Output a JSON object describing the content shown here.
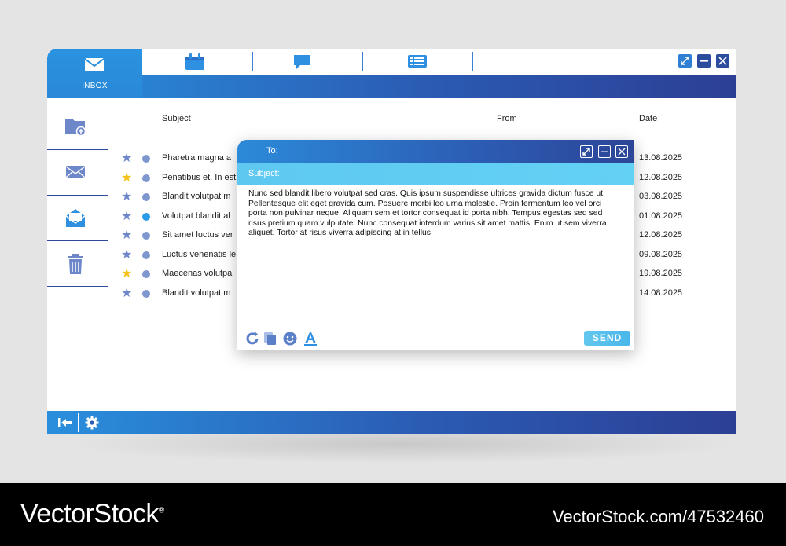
{
  "tabs": {
    "inbox_label": "INBOX",
    "icons": [
      "envelope-icon",
      "calendar-icon",
      "chat-icon",
      "list-icon"
    ]
  },
  "window_controls": [
    "expand-icon",
    "minimize-icon",
    "close-icon"
  ],
  "sidebar": {
    "items": [
      "new-folder-icon",
      "mail-icon",
      "open-mail-icon",
      "trash-icon"
    ]
  },
  "list": {
    "headers": {
      "subject": "Subject",
      "from": "From",
      "date": "Date"
    },
    "rows": [
      {
        "subject": "Pharetra magna a",
        "date": "13.08.2025",
        "starred": false,
        "unread": false
      },
      {
        "subject": "Penatibus et. In est",
        "date": "12.08.2025",
        "starred": true,
        "unread": false
      },
      {
        "subject": "Blandit volutpat m",
        "date": "03.08.2025",
        "starred": false,
        "unread": false
      },
      {
        "subject": "Volutpat blandit al",
        "date": "01.08.2025",
        "starred": false,
        "unread": true
      },
      {
        "subject": "Sit amet luctus ver",
        "date": "12.08.2025",
        "starred": false,
        "unread": false
      },
      {
        "subject": "Luctus venenatis le",
        "date": "09.08.2025",
        "starred": false,
        "unread": false
      },
      {
        "subject": "Maecenas volutpa",
        "date": "19.08.2025",
        "starred": true,
        "unread": false
      },
      {
        "subject": "Blandit volutpat m",
        "date": "14.08.2025",
        "starred": false,
        "unread": false
      }
    ]
  },
  "compose": {
    "to_label": "To:",
    "subject_label": "Subject:",
    "body": "Nunc sed blandit libero volutpat sed cras. Quis ipsum suspendisse ultrices gravida dictum fusce ut. Pellentesque elit eget gravida cum. Posuere morbi leo urna molestie. Proin fermentum leo vel orci porta non pulvinar neque. Aliquam sem et tortor consequat id porta nibh. Tempus egestas sed sed risus pretium quam vulputate. Nunc consequat interdum varius sit amet mattis. Enim ut sem viverra aliquet. Tortor at risus viverra adipiscing at in tellus.",
    "send_label": "SEND",
    "toolbar_icons": [
      "redo-icon",
      "copy-icon",
      "emoji-icon",
      "text-format-icon"
    ]
  },
  "bottom_bar": {
    "icons": [
      "logout-icon",
      "settings-icon"
    ]
  },
  "colors": {
    "accent": "#2a8fdd",
    "accent_dark": "#2c3f95",
    "star_active": "#f4c21b",
    "star_inactive": "#6d87c9",
    "unread_dot": "#2a9be8"
  },
  "watermark": {
    "brand": "VectorStock",
    "registered_mark": "®",
    "id": "VectorStock.com/47532460"
  }
}
